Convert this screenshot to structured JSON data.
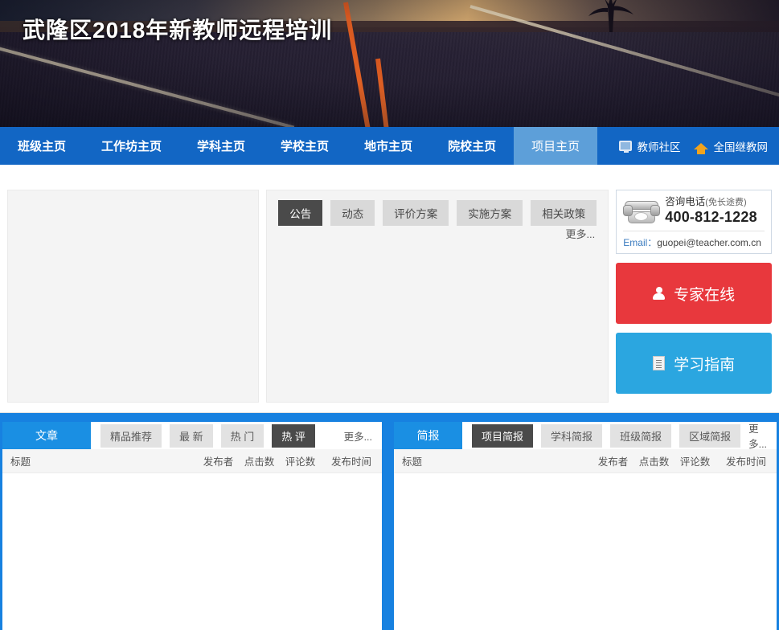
{
  "banner": {
    "title": "武隆区2018年新教师远程培训"
  },
  "nav": {
    "items": [
      {
        "label": "班级主页",
        "active": false
      },
      {
        "label": "工作坊主页",
        "active": false
      },
      {
        "label": "学科主页",
        "active": false
      },
      {
        "label": "学校主页",
        "active": false
      },
      {
        "label": "地市主页",
        "active": false
      },
      {
        "label": "院校主页",
        "active": false
      },
      {
        "label": "项目主页",
        "active": true
      }
    ],
    "links": [
      {
        "label": "教师社区",
        "icon": "monitor-icon"
      },
      {
        "label": "全国继教网",
        "icon": "home-icon"
      }
    ]
  },
  "main": {
    "tabs": [
      {
        "label": "公告",
        "active": true
      },
      {
        "label": "动态",
        "active": false
      },
      {
        "label": "评价方案",
        "active": false
      },
      {
        "label": "实施方案",
        "active": false
      },
      {
        "label": "相关政策",
        "active": false
      }
    ],
    "more_label": "更多...",
    "contact": {
      "title": "咨询电话",
      "title_note": "(免长途费)",
      "phone": "400-812-1228",
      "email_label": "Email：",
      "email_value": "guopei@teacher.com.cn"
    },
    "buttons": [
      {
        "label": "专家在线",
        "icon": "person-icon",
        "color": "#e8383d"
      },
      {
        "label": "学习指南",
        "icon": "document-icon",
        "color": "#2ba6e0"
      }
    ]
  },
  "panel_article": {
    "head_tab": "文章",
    "pills": [
      {
        "label": "精品推荐",
        "active": false
      },
      {
        "label": "最 新",
        "active": false
      },
      {
        "label": "热 门",
        "active": false
      },
      {
        "label": "热 评",
        "active": true
      }
    ],
    "more_label": "更多...",
    "columns": [
      "标题",
      "发布者",
      "点击数",
      "评论数",
      "发布时间"
    ],
    "rows": []
  },
  "panel_bulletin": {
    "head_tab": "简报",
    "pills": [
      {
        "label": "项目简报",
        "active": true
      },
      {
        "label": "学科简报",
        "active": false
      },
      {
        "label": "班级简报",
        "active": false
      },
      {
        "label": "区域简报",
        "active": false
      }
    ],
    "more_label": "更多...",
    "columns": [
      "标题",
      "发布者",
      "点击数",
      "评论数",
      "发布时间"
    ],
    "rows": []
  },
  "colors": {
    "nav_blue": "#1266c4",
    "nav_active": "#5d9fd9",
    "panel_blue": "#1781e0",
    "tab_blue": "#1a8fe3",
    "expert_red": "#e8383d",
    "guide_blue": "#2ba6e0",
    "pill_gray": "#d9d9d9",
    "pill_active": "#4a4a4a"
  }
}
